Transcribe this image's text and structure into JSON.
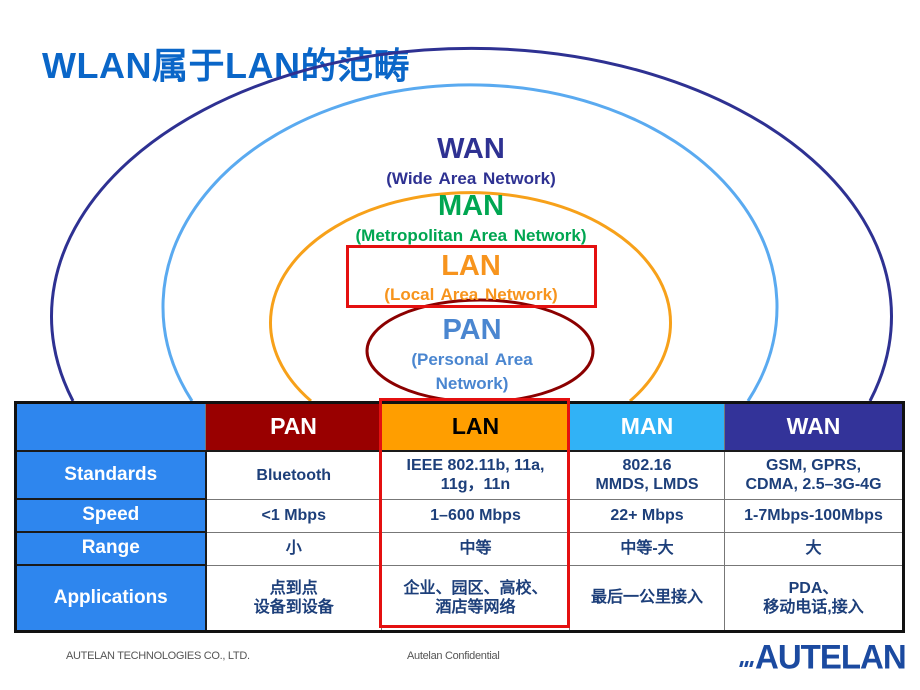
{
  "slide": {
    "title": "WLAN属于LAN的范畴"
  },
  "diagram": {
    "wan": {
      "name": "WAN",
      "full": "(Wide Area Network)",
      "color": "#2e3192"
    },
    "man": {
      "name": "MAN",
      "full": "(Metropolitan Area Network)",
      "color": "#00a651"
    },
    "lan": {
      "name": "LAN",
      "full": "(Local Area Network)",
      "color": "#f7941d"
    },
    "pan": {
      "name": "PAN",
      "full_line1": "(Personal Area",
      "full_line2": "Network)",
      "color": "#4a86d0",
      "ring_color": "#8b0000"
    },
    "highlight_color": "#e41010"
  },
  "table": {
    "columns": [
      "",
      "PAN",
      "LAN",
      "MAN",
      "WAN"
    ],
    "rows": [
      {
        "label": "Standards",
        "cells": [
          [
            "Bluetooth"
          ],
          [
            "IEEE 802.11b, 11a,",
            "11g，11n"
          ],
          [
            "802.16",
            "MMDS, LMDS"
          ],
          [
            "GSM, GPRS,",
            "CDMA, 2.5–3G-4G"
          ]
        ]
      },
      {
        "label": "Speed",
        "cells": [
          [
            "<1 Mbps"
          ],
          [
            "1–600 Mbps"
          ],
          [
            "22+ Mbps"
          ],
          [
            "1-7Mbps-100Mbps"
          ]
        ]
      },
      {
        "label": "Range",
        "cells": [
          [
            "小"
          ],
          [
            "中等"
          ],
          [
            "中等-大"
          ],
          [
            "大"
          ]
        ]
      },
      {
        "label": "Applications",
        "cells": [
          [
            "点到点",
            "设备到设备"
          ],
          [
            "企业、园区、高校、",
            "酒店等网络"
          ],
          [
            "最后一公里接入"
          ],
          [
            "PDA、",
            "移动电话,接入"
          ]
        ]
      }
    ],
    "highlighted_column": "LAN"
  },
  "footer": {
    "company": "AUTELAN TECHNOLOGIES CO., LTD.",
    "confidential": "Autelan Confidential",
    "logo_text": "AUTELAN"
  }
}
